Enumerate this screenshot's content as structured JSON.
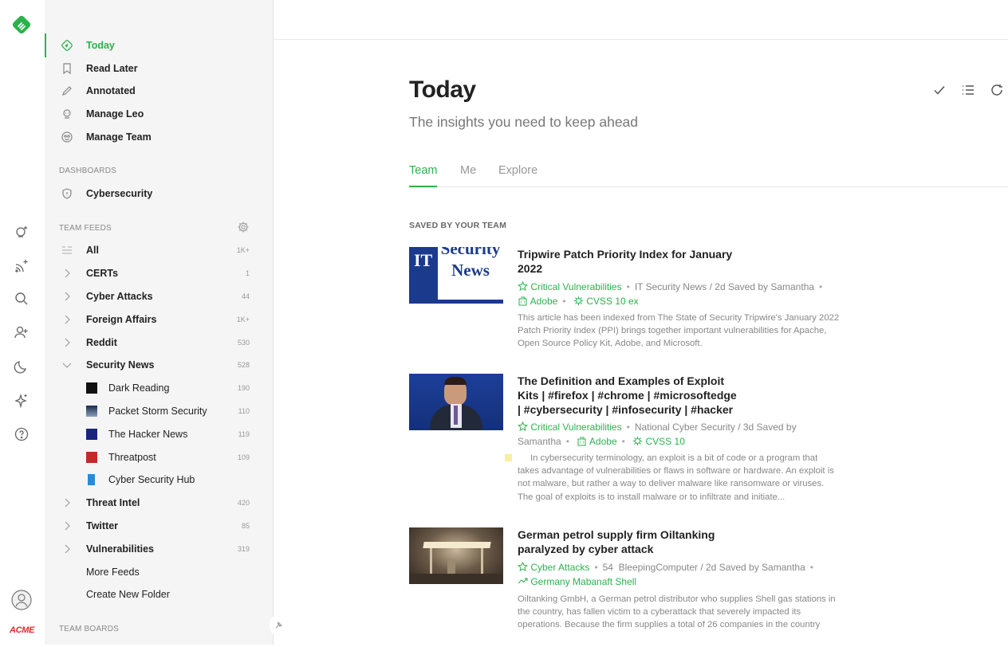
{
  "rail": {
    "logo_icon": "feedly-logo-icon",
    "acme_label": "ACME"
  },
  "nav": {
    "items": [
      {
        "label": "Today",
        "icon": "today-icon",
        "active": true
      },
      {
        "label": "Read Later",
        "icon": "bookmark-icon"
      },
      {
        "label": "Annotated",
        "icon": "pencil-icon"
      },
      {
        "label": "Manage Leo",
        "icon": "leo-icon"
      },
      {
        "label": "Manage Team",
        "icon": "team-icon"
      }
    ],
    "dashboards_header": "DASHBOARDS",
    "dashboards": [
      {
        "label": "Cybersecurity",
        "icon": "shield-icon"
      }
    ],
    "team_feeds_header": "TEAM FEEDS",
    "feeds": [
      {
        "label": "All",
        "count": "1K+"
      },
      {
        "label": "CERTs",
        "count": "1"
      },
      {
        "label": "Cyber Attacks",
        "count": "44"
      },
      {
        "label": "Foreign Affairs",
        "count": "1K+"
      },
      {
        "label": "Reddit",
        "count": "530"
      },
      {
        "label": "Security News",
        "count": "528"
      },
      {
        "label": "Dark Reading",
        "count": "190"
      },
      {
        "label": "Packet Storm Security",
        "count": "110"
      },
      {
        "label": "The Hacker News",
        "count": "119"
      },
      {
        "label": "Threatpost",
        "count": "109"
      },
      {
        "label": "Cyber Security Hub",
        "count": ""
      },
      {
        "label": "Threat Intel",
        "count": "420"
      },
      {
        "label": "Twitter",
        "count": "85"
      },
      {
        "label": "Vulnerabilities",
        "count": "319"
      },
      {
        "label": "More Feeds",
        "count": ""
      },
      {
        "label": "Create New Folder",
        "count": ""
      }
    ],
    "team_boards_header": "TEAM BOARDS"
  },
  "main": {
    "title": "Today",
    "subtitle": "The insights you need to keep ahead",
    "tabs": [
      "Team",
      "Me",
      "Explore"
    ],
    "section_header": "SAVED BY YOUR TEAM",
    "articles": [
      {
        "title": "Tripwire Patch Priority Index for January 2022",
        "topic": "Critical Vulnerabilities",
        "source": "IT Security News / 2d Saved by Samantha",
        "entity": "Adobe",
        "cvss": "CVSS 10 ex",
        "summary": "This article has been indexed from The State of Security Tripwire's January 2022 Patch Priority Index (PPI) brings together important vulnerabilities for Apache, Open Source Policy Kit, Adobe, and Microsoft.",
        "thumb_line1": "IT",
        "thumb_line2": "Security",
        "thumb_line3": "News"
      },
      {
        "title": "The Definition and Examples of Exploit Kits | #firefox | #chrome | #microsoftedge | #cybersecurity | #infosecurity | #hacker",
        "topic": "Critical Vulnerabilities",
        "source": "National Cyber Security / 3d Saved by",
        "source2": "Samantha",
        "entity": "Adobe",
        "cvss": "CVSS 10",
        "summary": "In cybersecurity terminology, an exploit is a bit of code or a program that takes advantage of vulnerabilities or flaws in software or hardware. An exploit is not malware, but rather a way to deliver malware like ransomware or viruses. The goal of exploits is to install malware or to infiltrate and initiate..."
      },
      {
        "title": "German petrol supply firm Oiltanking paralyzed by cyber attack",
        "topic": "Cyber Attacks",
        "count": "54",
        "source": "BleepingComputer / 2d Saved by Samantha",
        "trend": "Germany Mabanaft Shell",
        "summary": "Oiltanking GmbH, a German petrol distributor who supplies Shell gas stations in the country, has fallen victim to a cyberattack that severely impacted its operations. Because the firm supplies a total of 26 companies in the country"
      }
    ]
  },
  "colors": {
    "accent": "#2bb24c",
    "acme": "#e8262c"
  }
}
